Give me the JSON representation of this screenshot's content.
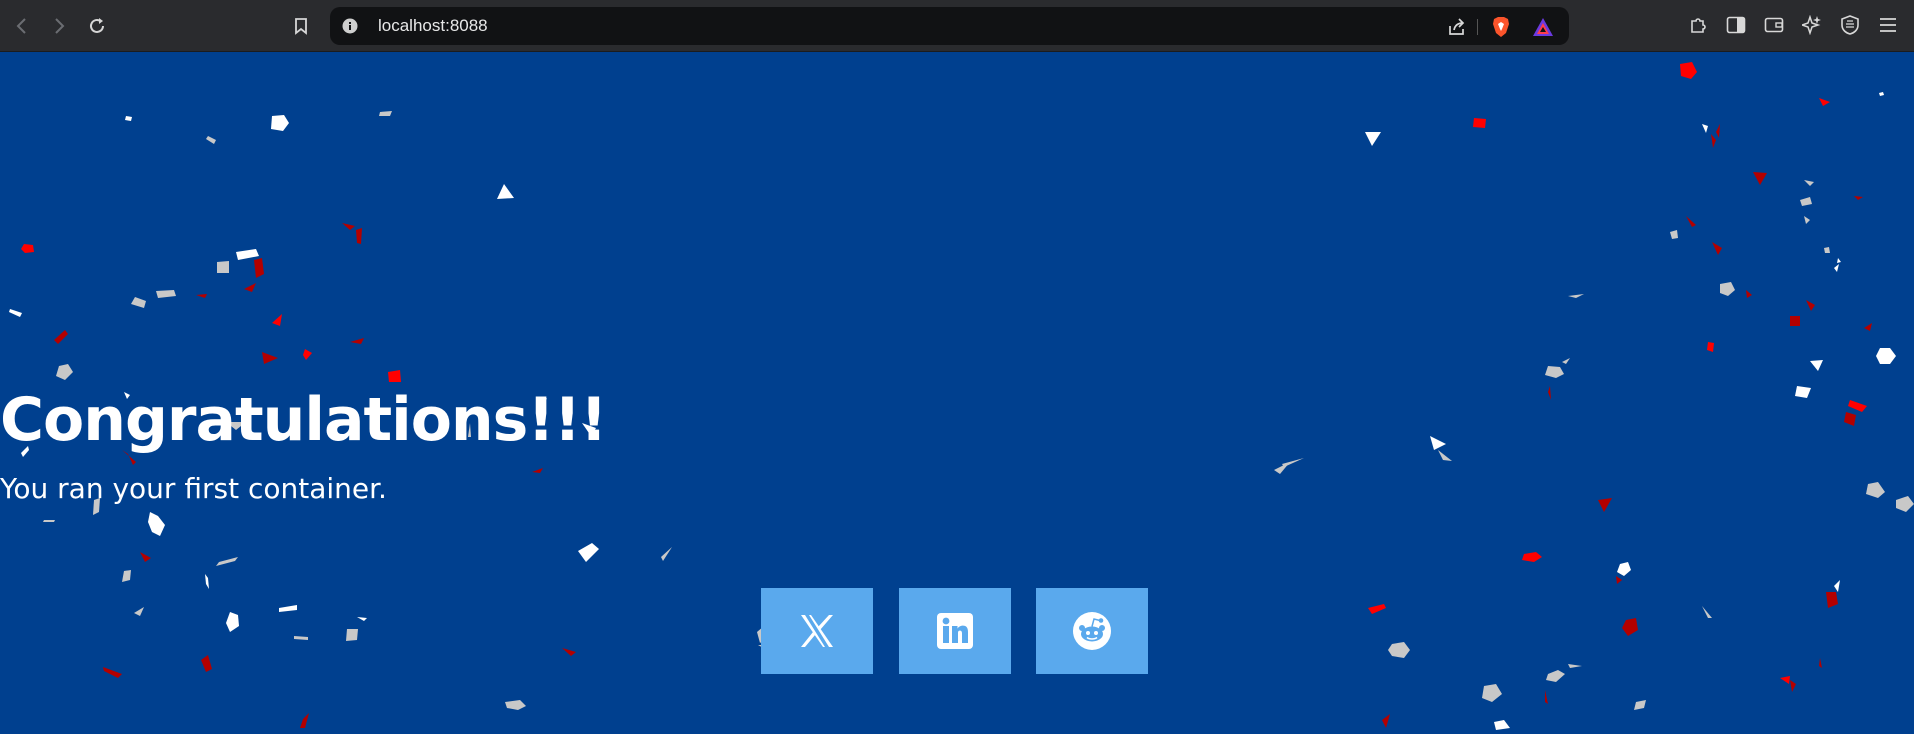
{
  "browser": {
    "url": "localhost:8088",
    "icons": [
      "back-icon",
      "forward-icon",
      "reload-icon",
      "bookmark-icon",
      "site-info-icon",
      "share-icon",
      "brave-shields-icon",
      "brave-rewards-icon",
      "extensions-icon",
      "sidebar-icon",
      "wallet-icon",
      "leo-ai-icon",
      "vpn-icon",
      "menu-icon"
    ]
  },
  "main": {
    "title": "Congratulations!!!",
    "subtitle": "You ran your first container.",
    "share_buttons": [
      "x-icon",
      "linkedin-icon",
      "reddit-icon"
    ]
  },
  "colors": {
    "page_background": "#00408f",
    "button_background": "#5aa9ed",
    "confetti": [
      "#ffffff",
      "#c8c8c8",
      "#ff0000",
      "#b30000"
    ]
  }
}
